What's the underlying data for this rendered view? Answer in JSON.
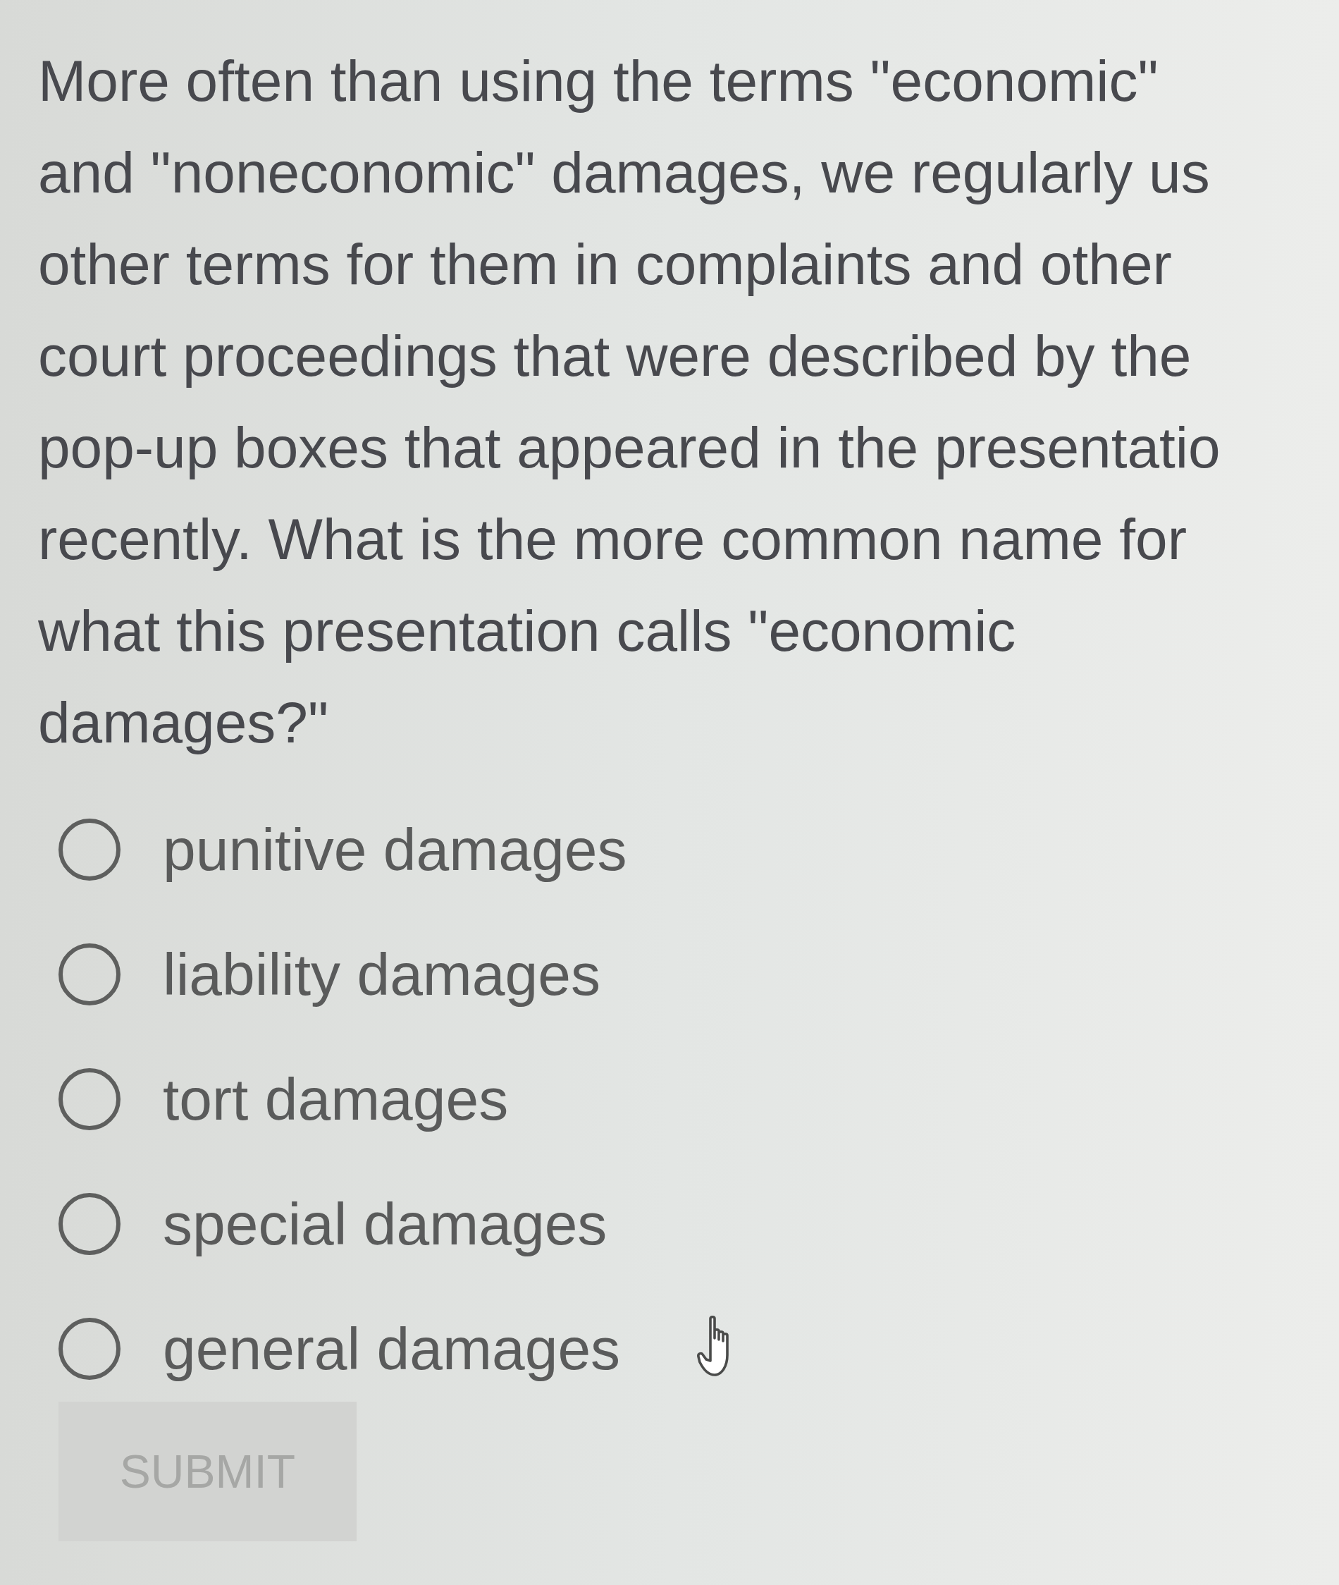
{
  "question": {
    "lines": [
      "More often than using the terms \"economic\"",
      "and \"noneconomic\" damages, we regularly us",
      "other terms for them in complaints and other",
      "court proceedings that were described by the",
      "pop-up boxes that appeared in the presentatio",
      "recently. What is the more common name for",
      "what this presentation calls \"economic",
      "damages?\""
    ]
  },
  "options": [
    {
      "label": "punitive damages",
      "selected": false
    },
    {
      "label": "liability damages",
      "selected": false
    },
    {
      "label": "tort damages",
      "selected": false
    },
    {
      "label": "special damages",
      "selected": false
    },
    {
      "label": "general damages",
      "selected": false
    }
  ],
  "submit": {
    "label": "SUBMIT",
    "disabled": true
  }
}
